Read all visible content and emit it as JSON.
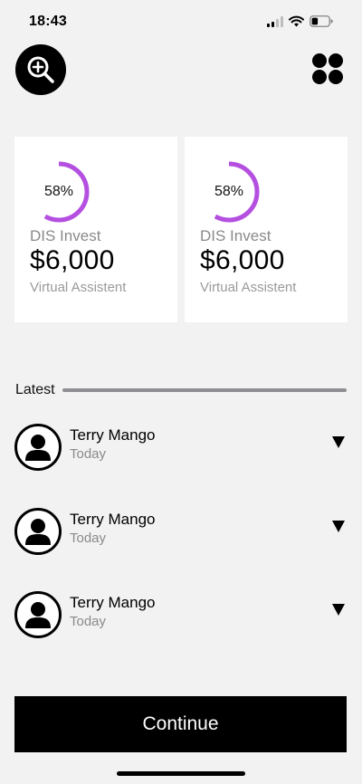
{
  "status_bar": {
    "time": "18:43"
  },
  "cards": [
    {
      "percent_label": "58%",
      "percent": 0.58,
      "title": "DIS Invest",
      "amount": "$6,000",
      "subtitle": "Virtual Assistent"
    },
    {
      "percent_label": "58%",
      "percent": 0.58,
      "title": "DIS Invest",
      "amount": "$6,000",
      "subtitle": "Virtual Assistent"
    }
  ],
  "latest": {
    "label": "Latest",
    "items": [
      {
        "name": "Terry Mango",
        "time": "Today"
      },
      {
        "name": "Terry Mango",
        "time": "Today"
      },
      {
        "name": "Terry Mango",
        "time": "Today"
      }
    ]
  },
  "continue_label": "Continue",
  "colors": {
    "accent": "#b44fe0",
    "background": "#f2f2f2"
  },
  "icons": [
    "zoom-in-icon",
    "grid-menu-icon",
    "user-avatar-icon",
    "caret-down-icon",
    "signal-icon",
    "wifi-icon",
    "battery-icon"
  ]
}
